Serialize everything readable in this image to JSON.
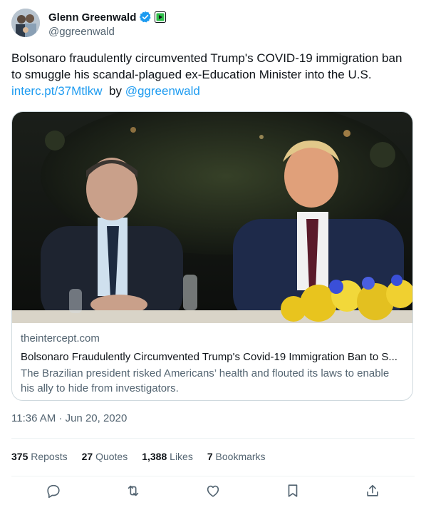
{
  "author": {
    "display_name": "Glenn Greenwald",
    "handle": "@ggreenwald",
    "verified_icon": "verified-badge-icon",
    "affiliate_icon": "rumble-play-icon"
  },
  "tweet": {
    "line1": "Bolsonaro fraudulently circumvented Trump's COVID-19 immigration ban",
    "line2": "to smuggle his scandal-plagued ex-Education Minister into the U.S.",
    "link_text": "interc.pt/37Mtlkw",
    "by_text": "by",
    "mention": "@ggreenwald"
  },
  "card": {
    "domain": "theintercept.com",
    "title": "Bolsonaro Fraudulently Circumvented Trump's Covid-19 Immigration Ban to S...",
    "description_line1": "The Brazilian president risked Americans’ health and flouted its laws to enable",
    "description_line2": "his ally to hide from investigators."
  },
  "timestamp": "11:36 AM · Jun 20, 2020",
  "stats": {
    "reposts_count": "375",
    "reposts_label": "Reposts",
    "quotes_count": "27",
    "quotes_label": "Quotes",
    "likes_count": "1,388",
    "likes_label": "Likes",
    "bookmarks_count": "7",
    "bookmarks_label": "Bookmarks"
  },
  "actions": [
    "reply-icon",
    "repost-icon",
    "like-icon",
    "bookmark-icon",
    "share-icon"
  ],
  "colors": {
    "link": "#1d9bf0",
    "secondary_text": "#536471",
    "border": "#cfd9de",
    "verified": "#1d9bf0"
  }
}
